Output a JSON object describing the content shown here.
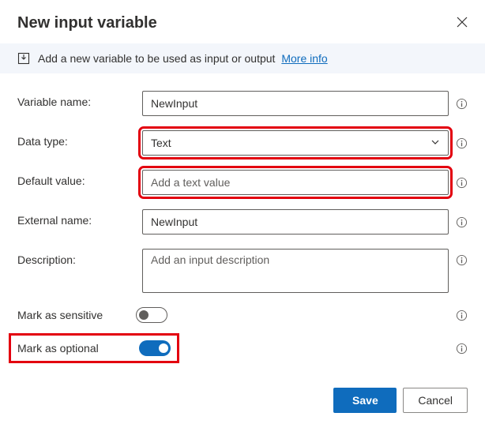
{
  "header": {
    "title": "New input variable"
  },
  "banner": {
    "text": "Add a new variable to be used as input or output",
    "link_text": "More info"
  },
  "labels": {
    "variable_name": "Variable name:",
    "data_type": "Data type:",
    "default_value": "Default value:",
    "external_name": "External name:",
    "description": "Description:",
    "mark_sensitive": "Mark as sensitive",
    "mark_optional": "Mark as optional"
  },
  "fields": {
    "variable_name": "NewInput",
    "data_type": "Text",
    "default_value": "",
    "default_value_placeholder": "Add a text value",
    "external_name": "NewInput",
    "description": "",
    "description_placeholder": "Add an input description"
  },
  "toggles": {
    "sensitive": false,
    "optional": true
  },
  "footer": {
    "save": "Save",
    "cancel": "Cancel"
  }
}
